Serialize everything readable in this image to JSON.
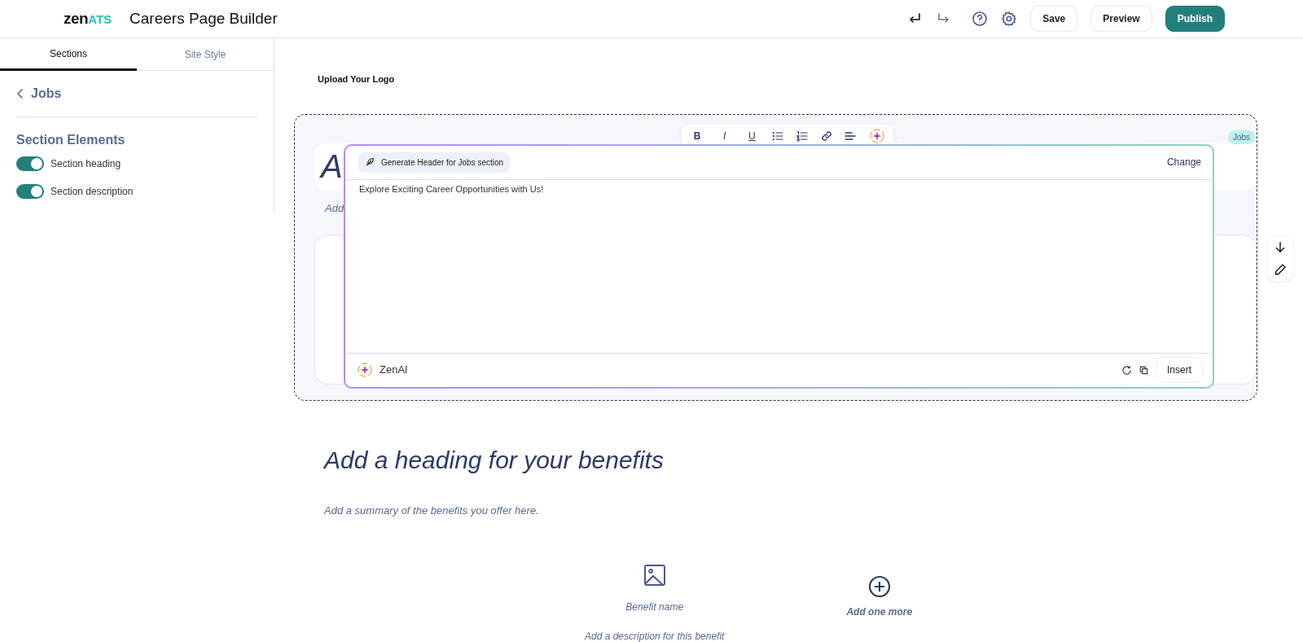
{
  "header": {
    "logo": {
      "brand": "zen",
      "accent": "ATS"
    },
    "title": "Careers Page Builder",
    "buttons": [
      {
        "label": "Save",
        "kind": "plain"
      },
      {
        "label": "Preview",
        "kind": "plain"
      },
      {
        "label": "Publish",
        "kind": "primary"
      }
    ]
  },
  "sidebar": {
    "tabs": [
      {
        "label": "Sections",
        "selected": true
      },
      {
        "label": "Site Style",
        "selected": false
      }
    ],
    "back": "Jobs",
    "section_title": "Section Elements",
    "toggles": [
      {
        "label": "Section heading",
        "on": true
      },
      {
        "label": "Section description",
        "on": true
      }
    ]
  },
  "canvas": {
    "logo_upload": "Upload Your Logo",
    "jobs_section": {
      "tag": "Jobs",
      "heading": "A",
      "description": "Add",
      "toolbar": {
        "glyphs": [
          "B",
          "I",
          "U"
        ]
      }
    },
    "ai_popup": {
      "prompt": "Generate Header for Jobs section",
      "change": "Change",
      "result": "Explore Exciting Career Opportunities with Us!",
      "brand": "ZenAI",
      "insert": "Insert"
    },
    "benefits": {
      "heading": "Add a heading for your benefits",
      "summary": "Add a summary of the benefits you offer here.",
      "items": [
        {
          "kind": "benefit",
          "name": "Benefit name",
          "description": "Add a description for this benefit"
        },
        {
          "kind": "add",
          "label": "Add one more"
        }
      ]
    }
  }
}
